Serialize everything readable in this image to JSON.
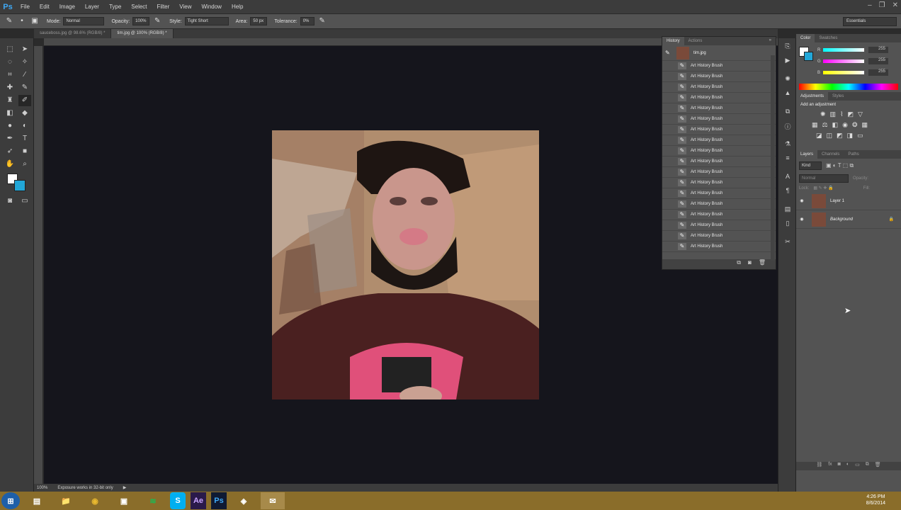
{
  "app": {
    "logo": "Ps"
  },
  "menu": [
    "File",
    "Edit",
    "Image",
    "Layer",
    "Type",
    "Select",
    "Filter",
    "View",
    "Window",
    "Help"
  ],
  "window_controls": [
    "–",
    "❐",
    "✕"
  ],
  "options": {
    "mode_label": "Mode:",
    "mode_value": "Normal",
    "opacity_label": "Opacity:",
    "opacity_value": "100%",
    "style_label": "Style:",
    "style_value": "Tight Short",
    "area_label": "Area:",
    "area_value": "50 px",
    "tolerance_label": "Tolerance:",
    "tolerance_value": "0%",
    "workspace": "Essentials"
  },
  "tabs": [
    {
      "label": "sauceboss.jpg @ 98.6% (RGB/8) *",
      "active": false
    },
    {
      "label": "tim.jpg @ 100% (RGB/8) *",
      "active": true
    }
  ],
  "status": {
    "zoom": "100%",
    "message": "Exposure works in 32-bit only"
  },
  "history": {
    "tabs": [
      "History",
      "Actions"
    ],
    "snapshot": "tim.jpg",
    "item_label": "Art History Brush",
    "items": [
      "Art History Brush",
      "Art History Brush",
      "Art History Brush",
      "Art History Brush",
      "Art History Brush",
      "Art History Brush",
      "Art History Brush",
      "Art History Brush",
      "Art History Brush",
      "Art History Brush",
      "Art History Brush",
      "Art History Brush",
      "Art History Brush",
      "Art History Brush",
      "Art History Brush",
      "Art History Brush",
      "Art History Brush",
      "Art History Brush"
    ]
  },
  "color": {
    "tabs": [
      "Color",
      "Swatches"
    ],
    "r_label": "R",
    "r": "255",
    "g_label": "G",
    "g": "255",
    "b_label": "B",
    "b": "255"
  },
  "adjustments": {
    "tabs": [
      "Adjustments",
      "Styles"
    ],
    "title": "Add an adjustment"
  },
  "layers": {
    "tabs": [
      "Layers",
      "Channels",
      "Paths"
    ],
    "kind": "Kind",
    "blend": "Normal",
    "opacity_label": "Opacity:",
    "lock_label": "Lock:",
    "fill_label": "Fill:",
    "items": [
      {
        "name": "Layer 1"
      },
      {
        "name": "Background"
      }
    ]
  },
  "taskbar": {
    "apps": [
      "⊞",
      "▤",
      "📁",
      "◉",
      "▣",
      "≋",
      "S",
      "Ae",
      "Ps",
      "◈",
      "✉"
    ],
    "time": "4:26 PM",
    "date": "8/6/2014"
  },
  "colors": {
    "accent": "#3fa9f5",
    "taskbar": "#8a6d2a",
    "canvas_bg": "#15151c"
  }
}
